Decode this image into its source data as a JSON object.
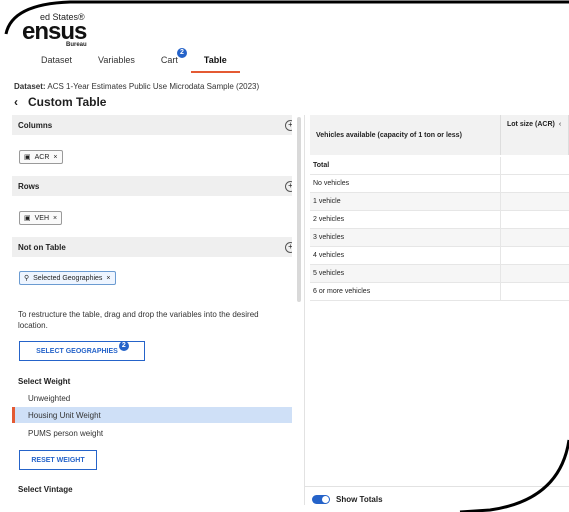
{
  "logo": {
    "line1": "ed States®",
    "line2": "ensus",
    "line3": "Bureau"
  },
  "nav": {
    "tabs": [
      {
        "label": "Dataset"
      },
      {
        "label": "Variables"
      },
      {
        "label": "Cart",
        "badge": "2"
      },
      {
        "label": "Table",
        "active": true
      }
    ]
  },
  "dataset": {
    "label": "Dataset:",
    "value": "ACS 1-Year Estimates Public Use Microdata Sample (2023)"
  },
  "page": {
    "title": "Custom Table",
    "back_icon": "chevron-left-icon"
  },
  "left": {
    "columns": {
      "label": "Columns",
      "chips": [
        "ACR"
      ]
    },
    "rows": {
      "label": "Rows",
      "chips": [
        "VEH"
      ]
    },
    "not_on_table": {
      "label": "Not on Table",
      "chips": [
        "Selected Geographies"
      ]
    },
    "help_text": "To restructure the table, drag and drop the variables into the desired location.",
    "select_geographies_button": "SELECT GEOGRAPHIES",
    "select_geographies_badge": "2",
    "weight": {
      "title": "Select Weight",
      "options": [
        "Unweighted",
        "Housing Unit Weight",
        "PUMS person weight"
      ],
      "selected": "Housing Unit Weight"
    },
    "reset_weight_button": "RESET WEIGHT",
    "vintage_label": "Select Vintage"
  },
  "table": {
    "row_header": "Vehicles available (capacity of 1 ton or less)",
    "col_header": "Lot size (ACR)",
    "rows": [
      "Total",
      "No vehicles",
      "1 vehicle",
      "2 vehicles",
      "3 vehicles",
      "4 vehicles",
      "5 vehicles",
      "6 or more vehicles"
    ]
  },
  "footer": {
    "show_totals": "Show Totals"
  },
  "colors": {
    "accent": "#e45a33",
    "primary": "#2563c9",
    "selected_bg": "#cfe0f7"
  }
}
